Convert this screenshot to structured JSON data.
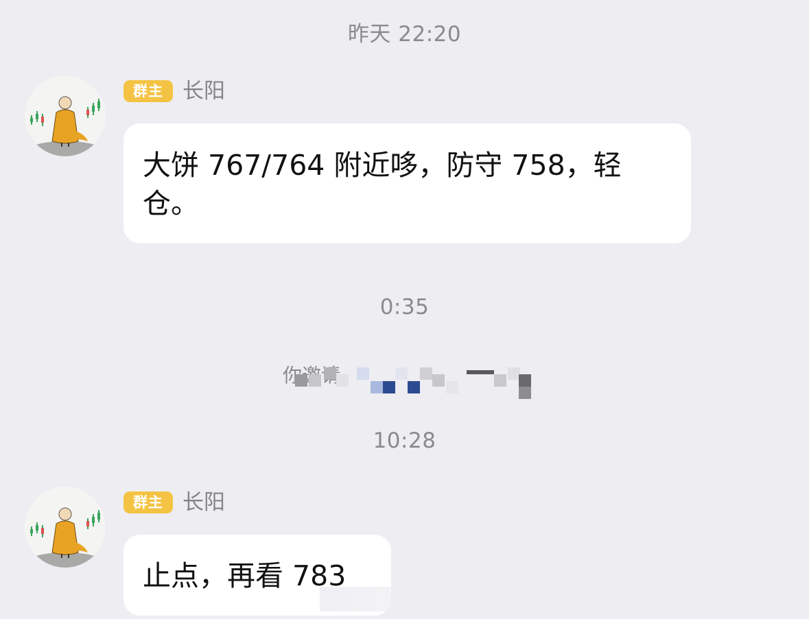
{
  "timestamps": {
    "t1": "昨天 22:20",
    "t2": "0:35",
    "t3": "10:28"
  },
  "messages": [
    {
      "role_badge": "群主",
      "sender": "长阳",
      "text": "大饼 767/764 附近哆，防守 758，轻仓。"
    },
    {
      "role_badge": "群主",
      "sender": "长阳",
      "text": "止点，再看 783"
    }
  ],
  "system_notice": {
    "text": "你邀请"
  },
  "colors": {
    "background": "#ededf2",
    "bubble": "#ffffff",
    "badge": "#f5c343",
    "timestamp_text": "#8a8a8e",
    "sender_text": "#858589"
  },
  "icons": {
    "avatar": "monk-avatar-with-candlestick-chart"
  }
}
